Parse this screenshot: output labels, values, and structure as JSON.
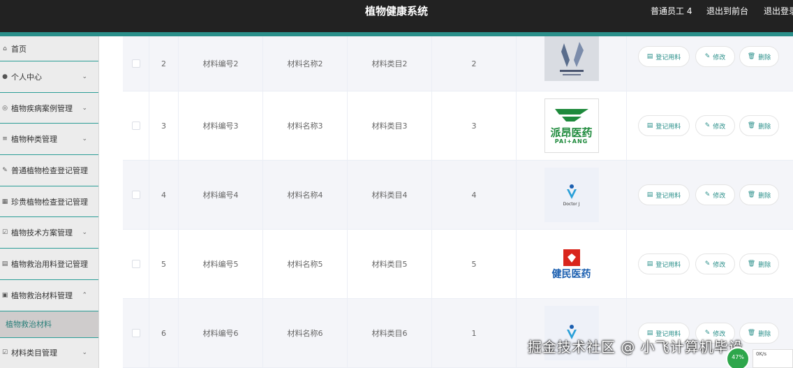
{
  "header": {
    "title": "植物健康系统",
    "user": "普通员工 4",
    "front": "退出到前台",
    "logout": "退出登录"
  },
  "sidebar": {
    "items": [
      {
        "label": "首页",
        "icon": "home-icon",
        "chev": ""
      },
      {
        "label": "个人中心",
        "icon": "user-icon",
        "chev": "⌄"
      },
      {
        "label": "植物疾病案例管理",
        "icon": "case-icon",
        "chev": "⌄"
      },
      {
        "label": "植物种类管理",
        "icon": "list-icon",
        "chev": "⌄"
      },
      {
        "label": "普通植物检查登记管理",
        "icon": "edit-icon",
        "chev": ""
      },
      {
        "label": "珍贵植物检查登记管理",
        "icon": "grid-icon",
        "chev": ""
      },
      {
        "label": "植物技术方案管理",
        "icon": "plan-icon",
        "chev": "⌄"
      },
      {
        "label": "植物救治用料登记管理",
        "icon": "register-icon",
        "chev": ""
      },
      {
        "label": "植物救治材料管理",
        "icon": "material-icon",
        "chev": "⌃"
      }
    ],
    "active_sub": "植物救治材料",
    "last_item": {
      "label": "材料类目管理",
      "icon": "category-icon",
      "chev": "⌄"
    }
  },
  "table": {
    "rows": [
      {
        "idx": "2",
        "code": "材料编号2",
        "name": "材料名称2",
        "cat": "材料类目2",
        "qty": "2",
        "logo": "logo-pharma"
      },
      {
        "idx": "3",
        "code": "材料编号3",
        "name": "材料名称3",
        "cat": "材料类目3",
        "qty": "3",
        "logo": "logo-paiang",
        "logo_text": "派昂医药",
        "logo_sub": "PAI+ANG"
      },
      {
        "idx": "4",
        "code": "材料编号4",
        "name": "材料名称4",
        "cat": "材料类目4",
        "qty": "4",
        "logo": "logo-doctorj",
        "logo_text": "Doctor J"
      },
      {
        "idx": "5",
        "code": "材料编号5",
        "name": "材料名称5",
        "cat": "材料类目5",
        "qty": "5",
        "logo": "logo-jianmin",
        "logo_text": "健民医药"
      },
      {
        "idx": "6",
        "code": "材料编号6",
        "name": "材料名称6",
        "cat": "材料类目6",
        "qty": "1",
        "logo": "logo-doctorj"
      }
    ],
    "actions": {
      "register": "登记用料",
      "edit": "修改",
      "delete": "删除"
    }
  },
  "overlay": {
    "watermark": "掘金技术社区 @ 小飞计算机毕设",
    "speed": "47%",
    "rate": "0K/s"
  },
  "colors": {
    "accent": "#2a8f8a",
    "topbar": "#222222",
    "green_logo": "#1e8a3c",
    "red_logo": "#d9251c",
    "blue_logo": "#1b5fb0"
  }
}
